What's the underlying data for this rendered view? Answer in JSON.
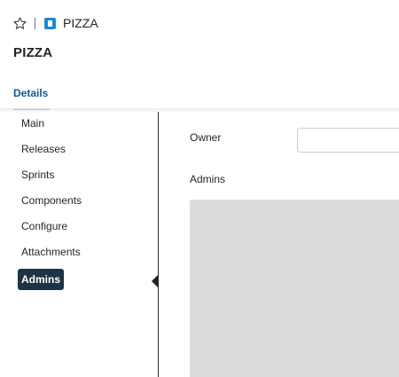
{
  "breadcrumb": {
    "favorite_icon": "star-outline-icon",
    "project_icon": "project-icon",
    "project_icon_color": "#1b8bd3",
    "label": "PIZZA"
  },
  "page": {
    "title": "PIZZA"
  },
  "tabs": [
    {
      "label": "Details",
      "active": true
    }
  ],
  "nav": {
    "items": [
      {
        "label": "Main",
        "active": false
      },
      {
        "label": "Releases",
        "active": false
      },
      {
        "label": "Sprints",
        "active": false
      },
      {
        "label": "Components",
        "active": false
      },
      {
        "label": "Configure",
        "active": false
      },
      {
        "label": "Attachments",
        "active": false
      },
      {
        "label": "Admins",
        "active": true
      }
    ]
  },
  "form": {
    "owner_label": "Owner",
    "owner_value": "",
    "admins_label": "Admins"
  },
  "colors": {
    "accent": "#0c5b9c",
    "active_nav_bg": "#1e3444",
    "panel_bg": "#dcdcdc"
  }
}
